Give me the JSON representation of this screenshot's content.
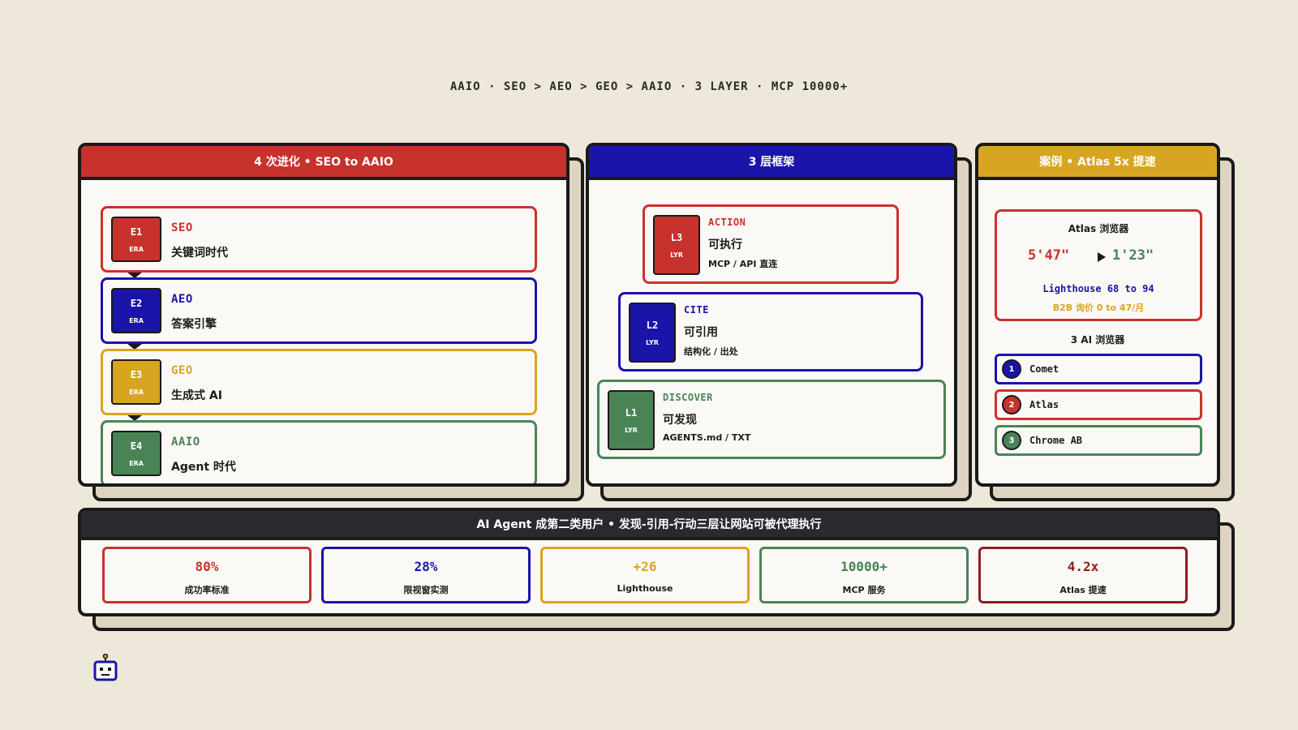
{
  "header": {
    "title": "AAIO · SEO > AEO > GEO > AAIO · 3 LAYER · MCP 10000+"
  },
  "evolution": {
    "title": "4 次进化 • SEO to AAIO",
    "eras": [
      {
        "id": "E1",
        "sub": "ERA",
        "name": "SEO",
        "desc": "关键词时代"
      },
      {
        "id": "E2",
        "sub": "ERA",
        "name": "AEO",
        "desc": "答案引擎"
      },
      {
        "id": "E3",
        "sub": "ERA",
        "name": "GEO",
        "desc": "生成式 AI"
      },
      {
        "id": "E4",
        "sub": "ERA",
        "name": "AAIO",
        "desc": "Agent 时代"
      }
    ]
  },
  "framework": {
    "title": "3 层框架",
    "layers": [
      {
        "id": "L3",
        "sub": "LYR",
        "name": "ACTION",
        "title": "可执行",
        "detail": "MCP / API 直连"
      },
      {
        "id": "L2",
        "sub": "LYR",
        "name": "CITE",
        "title": "可引用",
        "detail": "结构化 / 出处"
      },
      {
        "id": "L1",
        "sub": "LYR",
        "name": "DISCOVER",
        "title": "可发现",
        "detail": "AGENTS.md / TXT"
      }
    ]
  },
  "case": {
    "title": "案例 • Atlas 5x 提速",
    "browser_title": "Atlas 浏览器",
    "time_before": "5'47\"",
    "time_after": "1'23\"",
    "lighthouse": "Lighthouse 68 to 94",
    "b2b": "B2B 询价 0 to 47/月",
    "ai_title": "3 AI 浏览器",
    "browsers": [
      {
        "num": "1",
        "name": "Comet"
      },
      {
        "num": "2",
        "name": "Atlas"
      },
      {
        "num": "3",
        "name": "Chrome AB"
      }
    ]
  },
  "summary": {
    "title": "AI Agent 成第二类用户 • 发现-引用-行动三层让网站可被代理执行",
    "stats": [
      {
        "value": "80%",
        "label": "成功率标准"
      },
      {
        "value": "28%",
        "label": "限视窗实测"
      },
      {
        "value": "+26",
        "label": "Lighthouse"
      },
      {
        "value": "10000+",
        "label": "MCP 服务"
      },
      {
        "value": "4.2x",
        "label": "Atlas 提速"
      }
    ]
  },
  "colors": {
    "red": "#c8322c",
    "blue": "#1a14a8",
    "gold": "#d8a523",
    "green": "#4a8456",
    "dark_red": "#8b1e22",
    "ink": "#1a1a1a",
    "background": "#ede8da"
  },
  "icons": {
    "robot": "robot-icon",
    "arrow": "play-arrow-icon"
  }
}
